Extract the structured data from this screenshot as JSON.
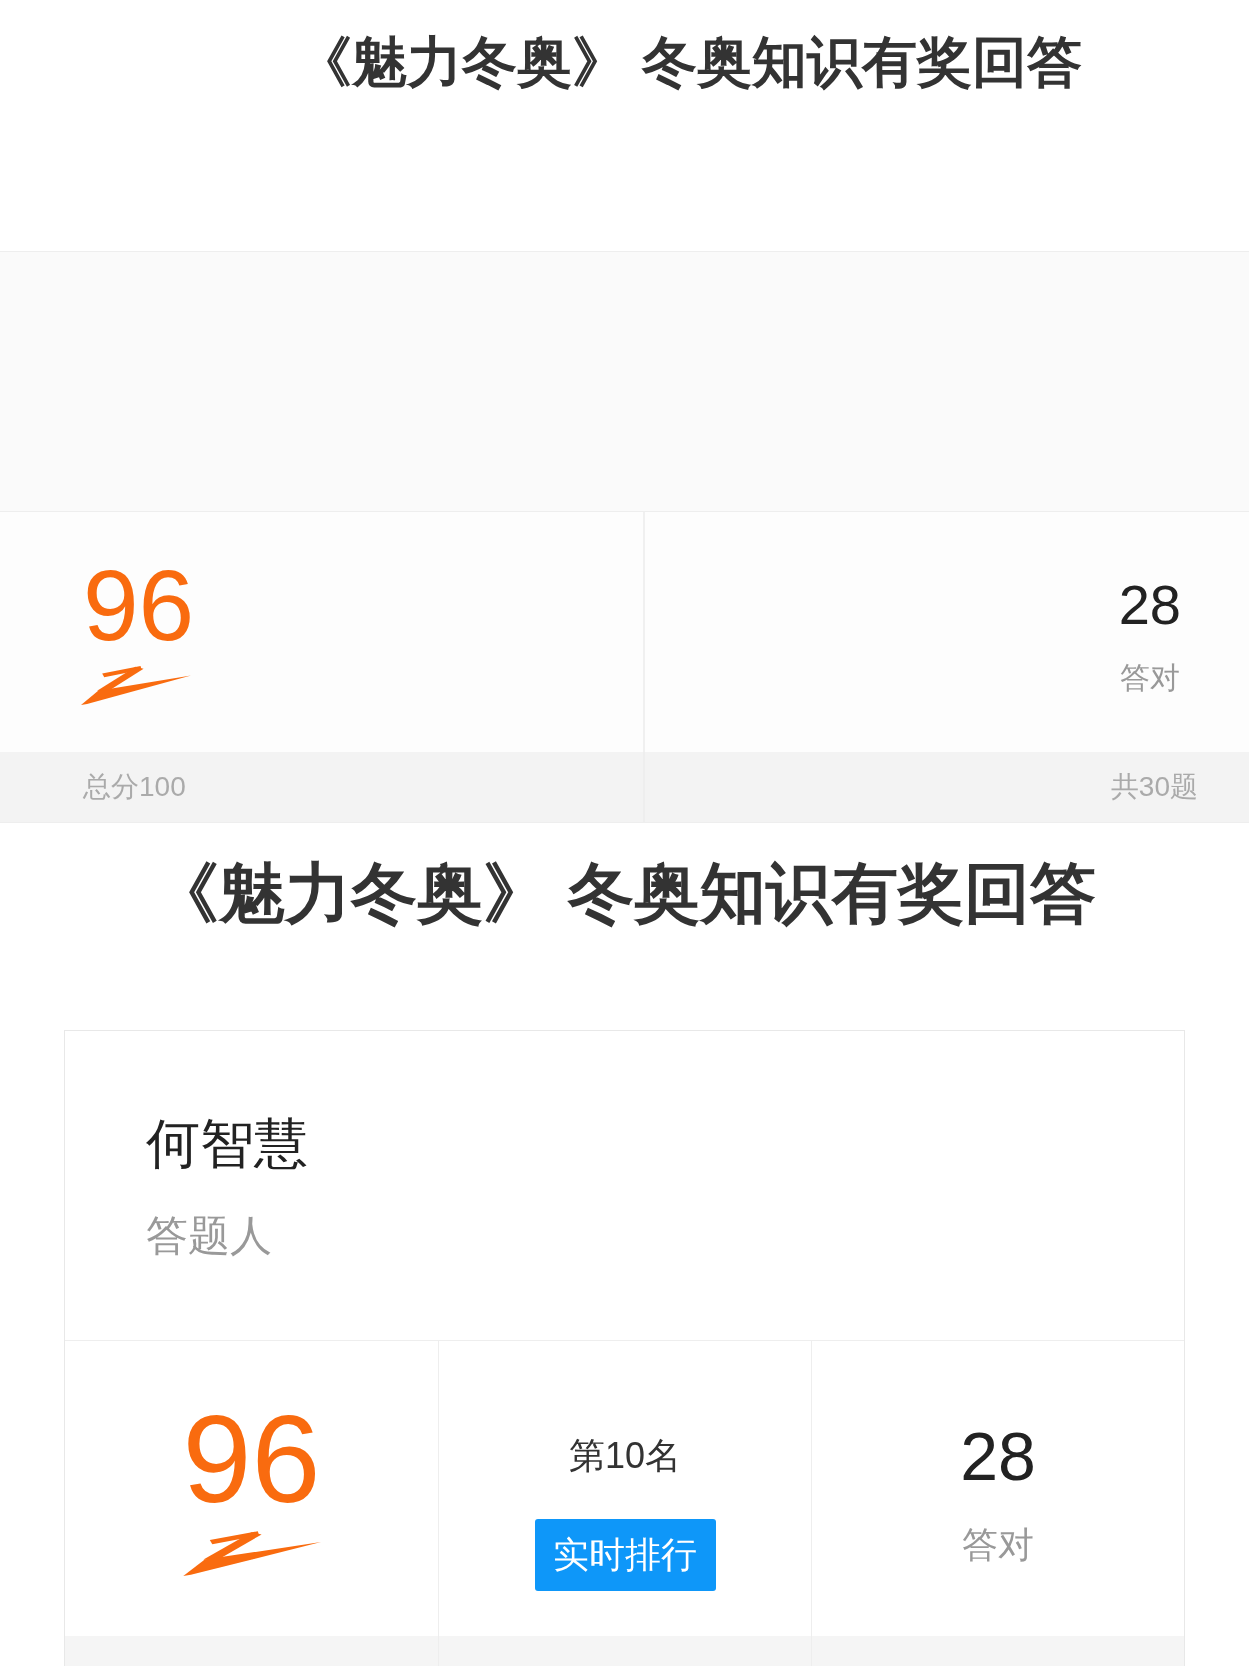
{
  "header": {
    "title": "《魅力冬奥》 冬奥知识有奖回答"
  },
  "summary": {
    "score": {
      "value": "96",
      "footer": "总分100"
    },
    "correct": {
      "value": "28",
      "label": "答对",
      "footer": "共30题"
    }
  },
  "title": "《魅力冬奥》 冬奥知识有奖回答",
  "result_card": {
    "name": "何智慧",
    "role": "答题人",
    "stats": [
      {
        "kind": "score",
        "value": "96"
      },
      {
        "kind": "rank",
        "value": "第10名",
        "button": "实时排行"
      },
      {
        "kind": "correct",
        "value": "28",
        "label": "答对"
      }
    ]
  }
}
